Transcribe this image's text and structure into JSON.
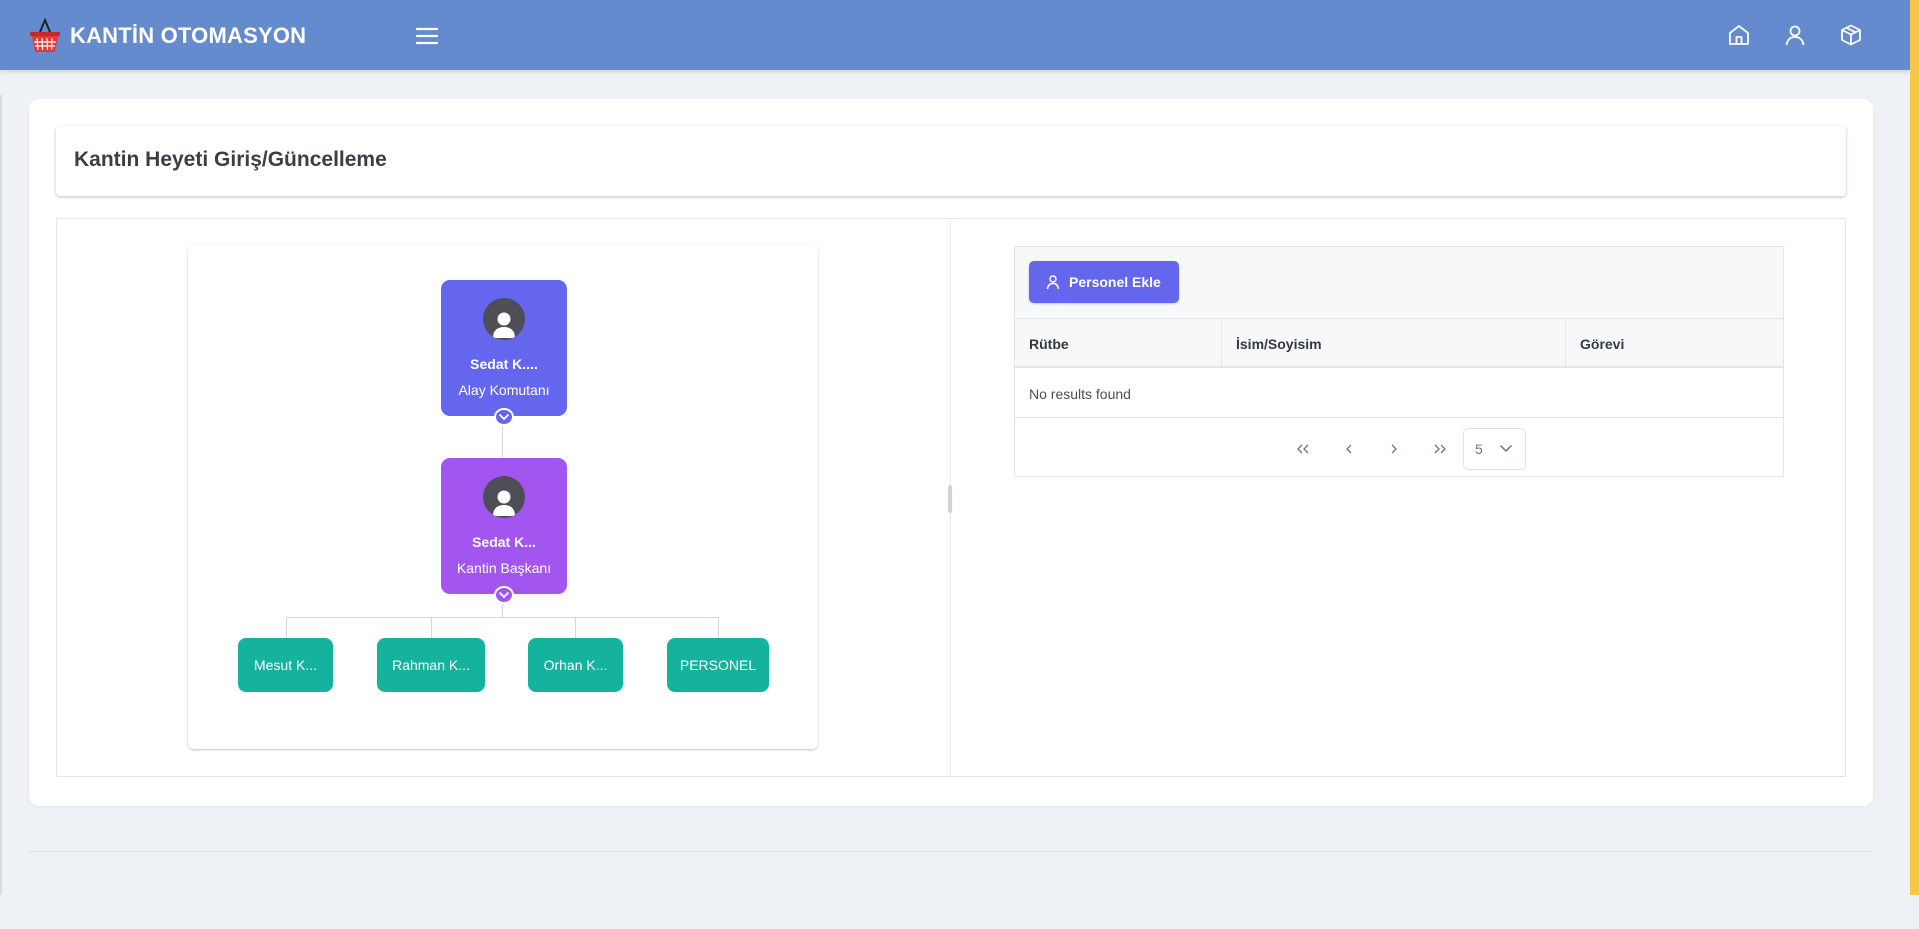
{
  "app": {
    "title": "KANTİN OTOMASYON"
  },
  "topbar_icons": [
    "home-icon",
    "user-icon",
    "box-icon"
  ],
  "page": {
    "title": "Kantin Heyeti Giriş/Güncelleme"
  },
  "org_chart": {
    "root": {
      "name": "Sedat K....",
      "role": "Alay Komutanı"
    },
    "head": {
      "name": "Sedat K...",
      "role": "Kantin Başkanı"
    },
    "members": [
      "Mesut K...",
      "Rahman K...",
      "Orhan K...",
      "PERSONEL"
    ]
  },
  "personnel_table": {
    "add_button": "Personel Ekle",
    "columns": [
      "Rütbe",
      "İsim/Soyisim",
      "Görevi"
    ],
    "empty_message": "No results found",
    "rows_per_page": "5"
  },
  "colors": {
    "topbar": "#648bcd",
    "primary": "#6466ee",
    "purple": "#a356ef",
    "teal": "#15b29e",
    "accent_strip": "#f6c744"
  }
}
